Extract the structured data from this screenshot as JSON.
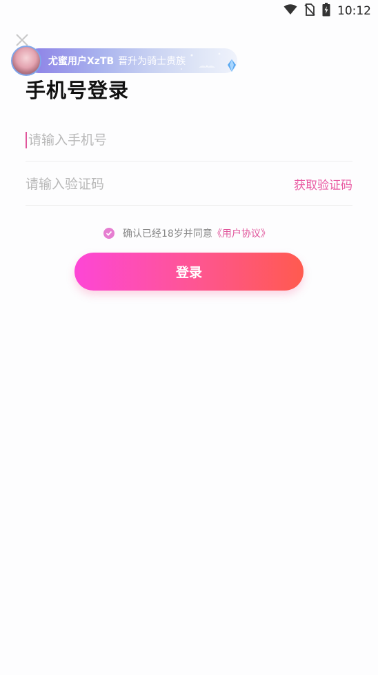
{
  "status_bar": {
    "time": "10:12",
    "icons": [
      "wifi-icon",
      "no-sim-icon",
      "battery-charging-icon"
    ]
  },
  "notification": {
    "username": "尤蜜用户XzTB",
    "message": "晋升为骑士贵族"
  },
  "page": {
    "title": "手机号登录"
  },
  "form": {
    "phone_placeholder": "请输入手机号",
    "code_placeholder": "请输入验证码",
    "get_code_label": "获取验证码",
    "agreement_text": "确认已经18岁并同意",
    "agreement_link": "《用户协议》",
    "agreement_checked": true,
    "login_label": "登录"
  },
  "colors": {
    "accent_pink": "#e0559b",
    "button_gradient_start": "#fd46d6",
    "button_gradient_end": "#ff5a4f"
  }
}
